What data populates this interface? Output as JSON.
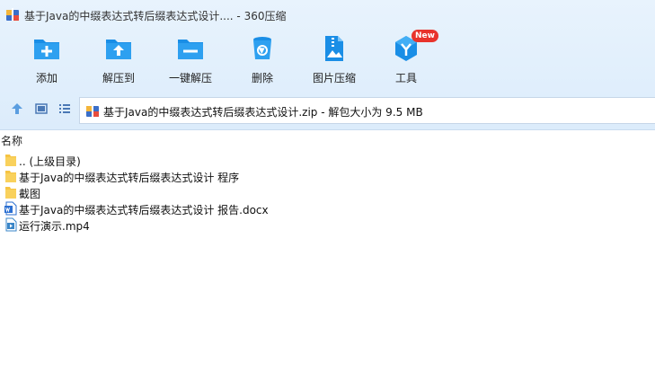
{
  "window": {
    "title": "基于Java的中缀表达式转后缀表达式设计....  - 360压缩"
  },
  "toolbar": {
    "items": [
      {
        "label": "添加",
        "icon": "add-folder-icon"
      },
      {
        "label": "解压到",
        "icon": "extract-folder-icon"
      },
      {
        "label": "一键解压",
        "icon": "one-click-extract-icon"
      },
      {
        "label": "删除",
        "icon": "trash-icon"
      },
      {
        "label": "图片压缩",
        "icon": "image-zip-icon"
      },
      {
        "label": "工具",
        "icon": "tools-icon",
        "badge": "New"
      }
    ]
  },
  "nav": {
    "path": "基于Java的中缀表达式转后缀表达式设计.zip - 解包大小为 9.5 MB"
  },
  "list": {
    "column_name": "名称",
    "rows": [
      {
        "name": ".. (上级目录)",
        "type": "folder"
      },
      {
        "name": "基于Java的中缀表达式转后缀表达式设计 程序",
        "type": "folder"
      },
      {
        "name": "截图",
        "type": "folder"
      },
      {
        "name": "基于Java的中缀表达式转后缀表达式设计 报告.docx",
        "type": "docx"
      },
      {
        "name": "运行演示.mp4",
        "type": "mp4"
      }
    ]
  },
  "colors": {
    "accent": "#1a8ee6",
    "folder": "#f6c443",
    "badge": "#e8332c"
  }
}
